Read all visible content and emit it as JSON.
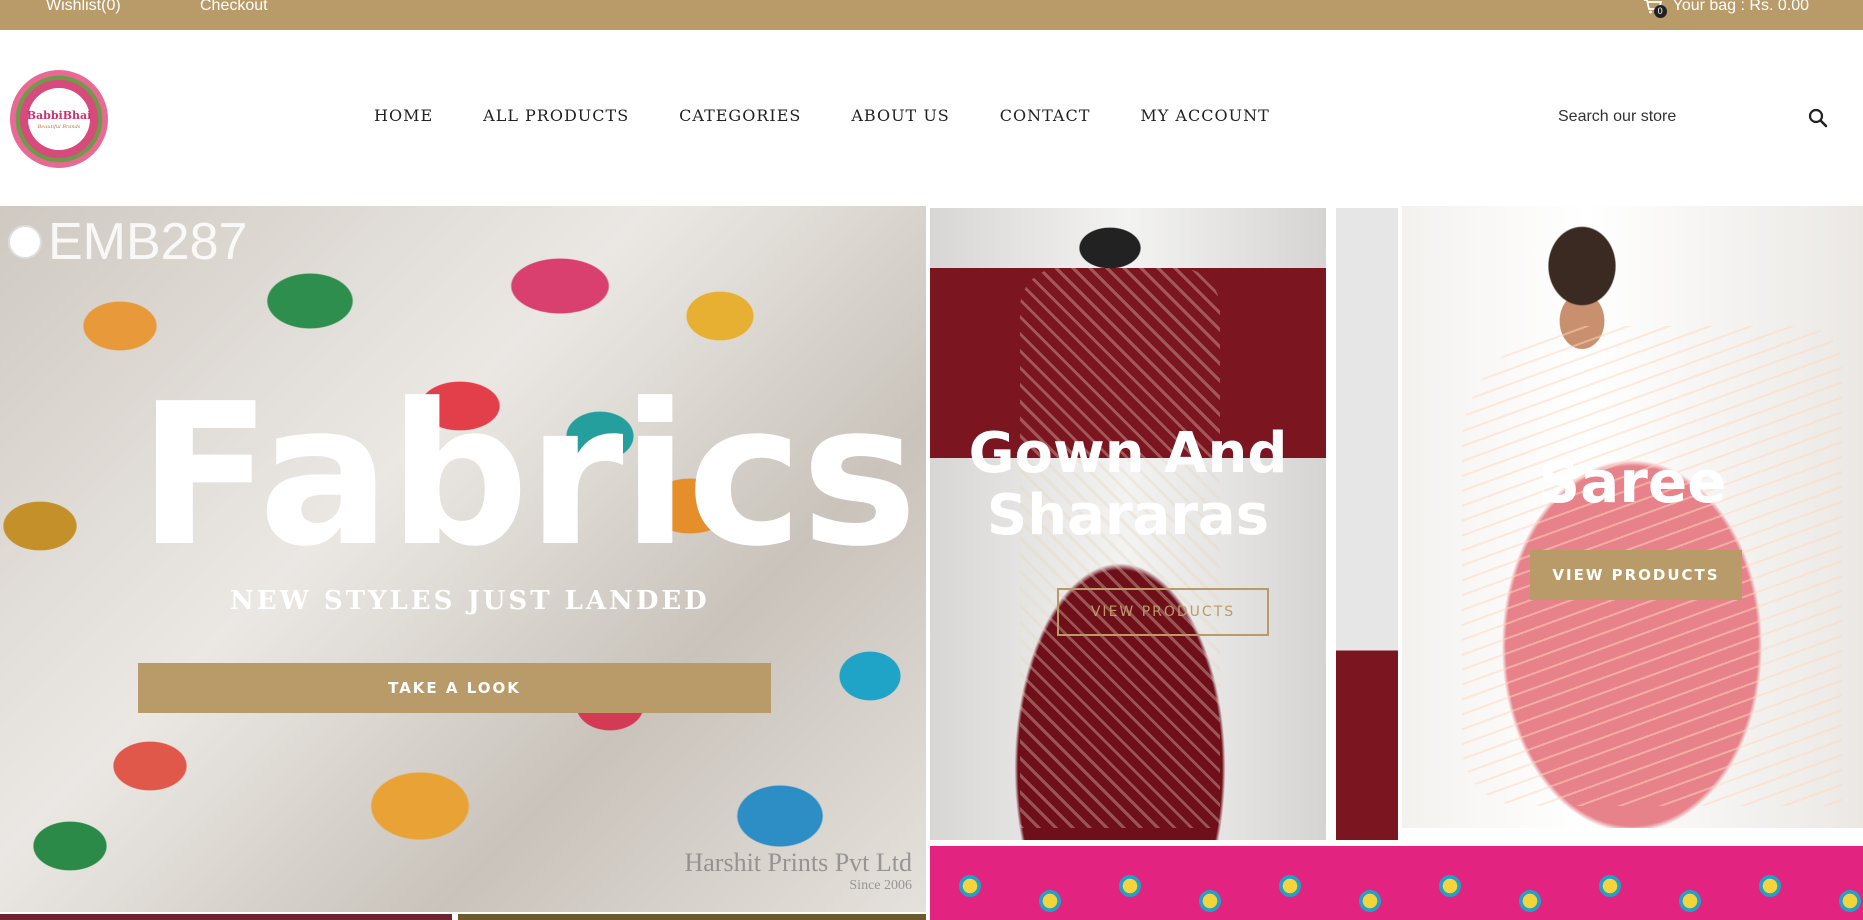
{
  "topbar": {
    "wishlist": "Wishlist(0)",
    "checkout": "Checkout",
    "cart_count": "0",
    "bag": "Your bag : Rs. 0.00",
    "cart_icon": "cart-icon"
  },
  "header": {
    "logo_text": "BabbiBhai",
    "logo_subtext": "Beautiful Brands",
    "nav": [
      "HOME",
      "ALL PRODUCTS",
      "CATEGORIES",
      "ABOUT US",
      "CONTACT",
      "MY ACCOUNT"
    ],
    "search_placeholder": "Search our store",
    "search_icon": "search-icon"
  },
  "banners": {
    "fabrics": {
      "watermark": "EMB287",
      "title": "Fabrics",
      "subtitle": "NEW STYLES JUST LANDED",
      "button": "TAKE A LOOK",
      "credit_line1": "Harshit Prints Pvt Ltd",
      "credit_line2": "Since 2006"
    },
    "gown": {
      "title": "Gown And Shararas",
      "button": "VIEW PRODUCTS"
    },
    "saree": {
      "title": "Saree",
      "button": "VIEW PRODUCTS"
    }
  },
  "colors": {
    "accent": "#b89b68",
    "text": "#222222",
    "background": "#ffffff"
  }
}
